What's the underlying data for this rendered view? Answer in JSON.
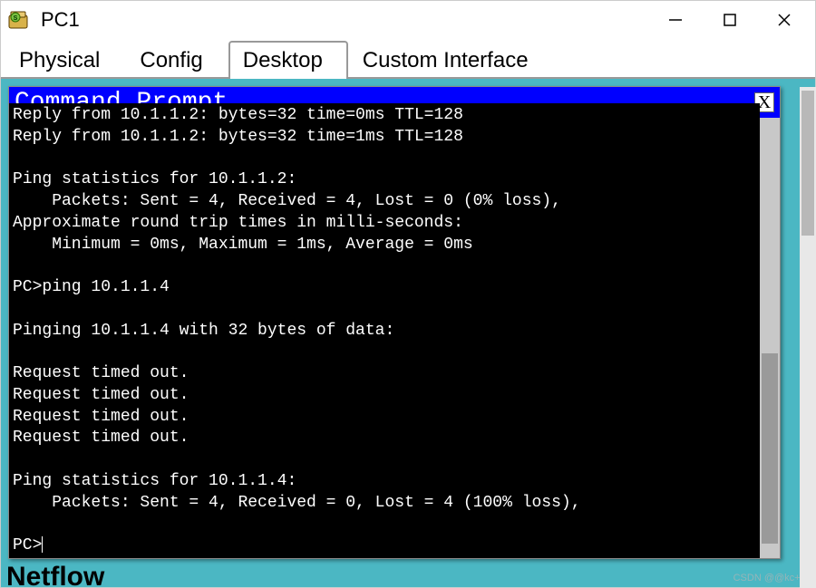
{
  "window": {
    "title": "PC1"
  },
  "tabs": {
    "physical": "Physical",
    "config": "Config",
    "desktop": "Desktop",
    "custom": "Custom Interface",
    "active": "desktop"
  },
  "cmd": {
    "title": "Command Prompt",
    "close_label": "X"
  },
  "terminal": {
    "lines": [
      "Reply from 10.1.1.2: bytes=32 time=0ms TTL=128",
      "Reply from 10.1.1.2: bytes=32 time=1ms TTL=128",
      "",
      "Ping statistics for 10.1.1.2:",
      "    Packets: Sent = 4, Received = 4, Lost = 0 (0% loss),",
      "Approximate round trip times in milli-seconds:",
      "    Minimum = 0ms, Maximum = 1ms, Average = 0ms",
      "",
      "PC>ping 10.1.1.4",
      "",
      "Pinging 10.1.1.4 with 32 bytes of data:",
      "",
      "Request timed out.",
      "Request timed out.",
      "Request timed out.",
      "Request timed out.",
      "",
      "Ping statistics for 10.1.1.4:",
      "    Packets: Sent = 4, Received = 0, Lost = 4 (100% loss),",
      ""
    ],
    "prompt": "PC>"
  },
  "background_label": "Netflow",
  "watermark": "CSDN @@kc++"
}
